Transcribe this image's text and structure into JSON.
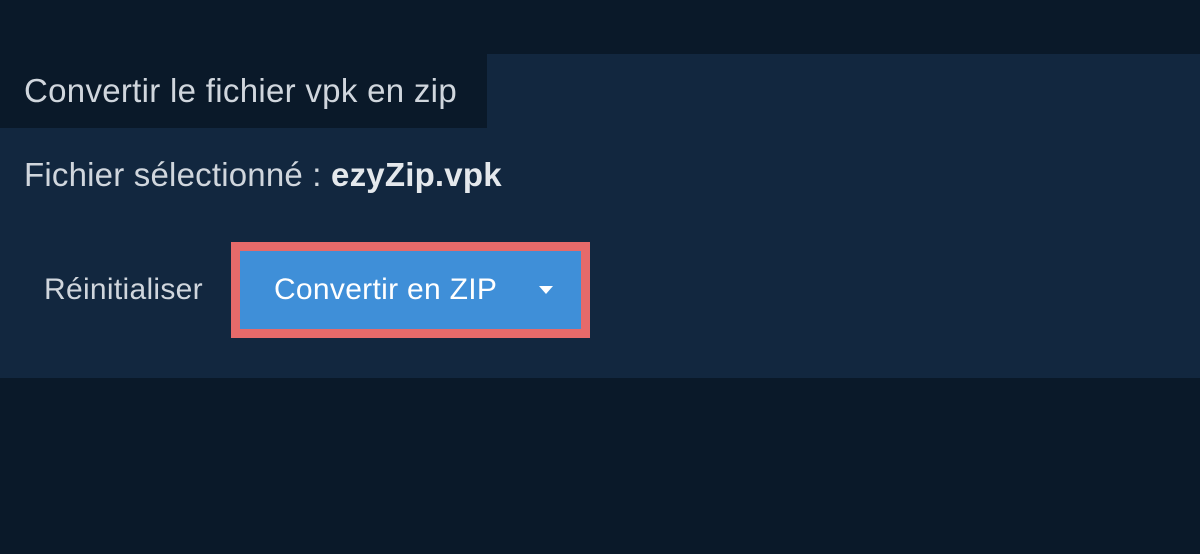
{
  "tab": {
    "title": "Convertir le fichier vpk en zip"
  },
  "selected": {
    "label": "Fichier sélectionné : ",
    "filename": "ezyZip.vpk"
  },
  "actions": {
    "reset_label": "Réinitialiser",
    "convert_label": "Convertir en ZIP"
  },
  "colors": {
    "highlight_border": "#e66a6a",
    "button_bg": "#3f8fd8",
    "panel_bg": "#12273f",
    "page_bg": "#0a1929"
  }
}
